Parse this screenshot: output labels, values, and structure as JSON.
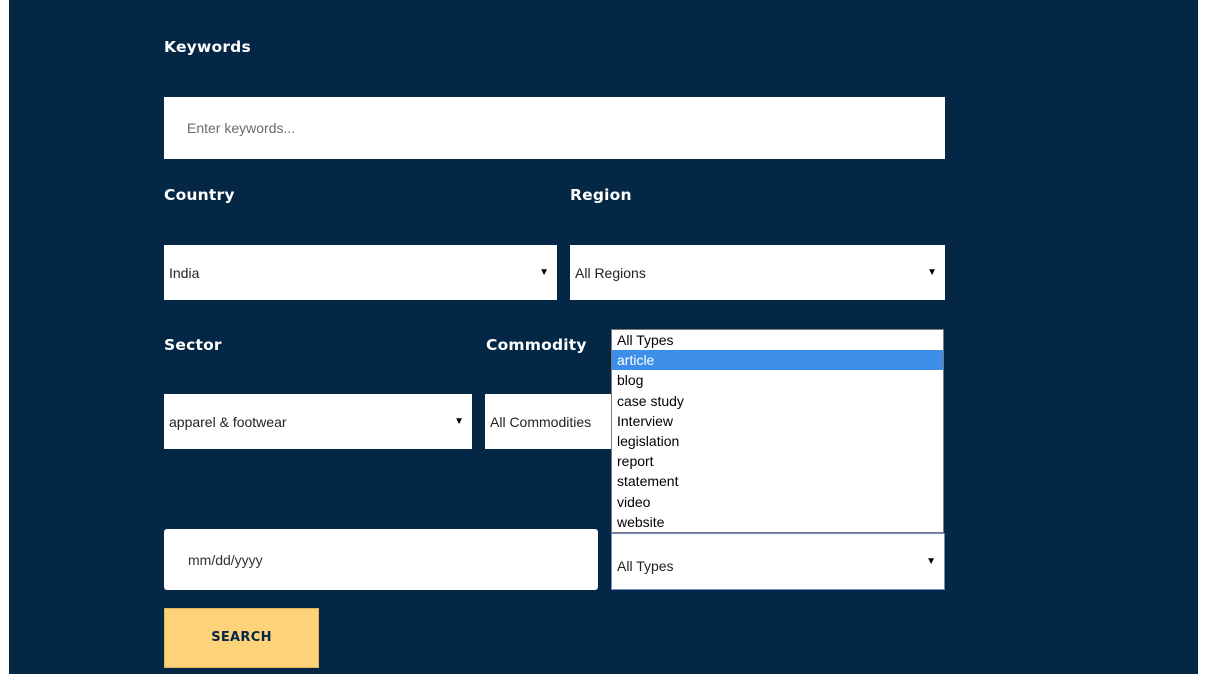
{
  "form": {
    "keywords": {
      "label": "Keywords",
      "placeholder": "Enter keywords..."
    },
    "country": {
      "label": "Country",
      "value": "India"
    },
    "region": {
      "label": "Region",
      "value": "All Regions"
    },
    "sector": {
      "label": "Sector",
      "value": "apparel & footwear"
    },
    "commodity": {
      "label": "Commodity",
      "value": "All Commodities"
    },
    "date": {
      "placeholder": "mm/dd/yyyy"
    },
    "type": {
      "value": "All Types",
      "options": [
        "All Types",
        "article",
        "blog",
        "case study",
        "Interview",
        "legislation",
        "report",
        "statement",
        "video",
        "website"
      ],
      "highlighted": "article"
    },
    "search_label": "SEARCH"
  },
  "icons": {
    "dropdown_arrow": "▼"
  },
  "colors": {
    "background": "#042746",
    "button": "#fdd37a",
    "highlight": "#3d8ee8"
  }
}
